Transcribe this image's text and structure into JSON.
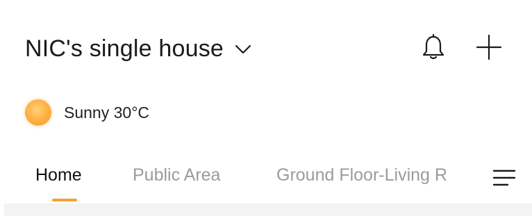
{
  "header": {
    "home_name": "NIC's single house",
    "chevron_icon": "chevron-down-icon",
    "bell_icon": "bell-icon",
    "add_icon": "plus-icon"
  },
  "weather": {
    "icon": "sun-icon",
    "text": "Sunny 30°C"
  },
  "tabs": [
    {
      "label": "Home",
      "active": true
    },
    {
      "label": "Public Area",
      "active": false
    },
    {
      "label": "Ground Floor-Living R",
      "active": false
    }
  ],
  "tabs_menu_icon": "menu-lines-icon",
  "colors": {
    "accent": "#f5a031",
    "text_primary": "#1a1a1a",
    "text_inactive": "#9b9b9b",
    "content_bg": "#f3f3f3"
  }
}
